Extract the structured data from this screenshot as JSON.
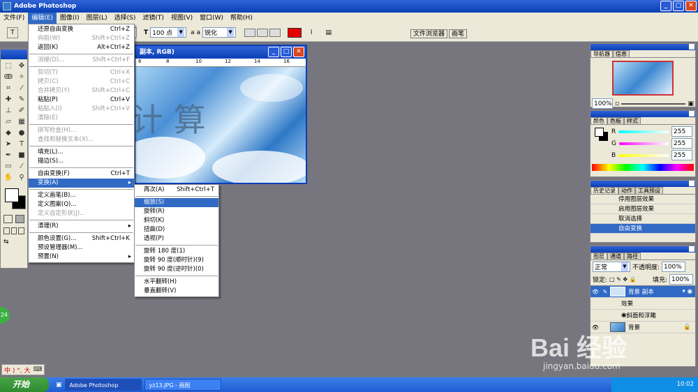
{
  "app": {
    "title": "Adobe Photoshop"
  },
  "menubar": [
    "文件(F)",
    "编辑(E)",
    "图像(I)",
    "图层(L)",
    "选择(S)",
    "滤镜(T)",
    "视图(V)",
    "窗口(W)",
    "帮助(H)"
  ],
  "options": {
    "font_size": "100 点",
    "antialias_icon": "a a",
    "antialias": "锐化",
    "color": "#e60000"
  },
  "palette_well": [
    "文件浏览器",
    "画笔"
  ],
  "document": {
    "title": "副本, RGB)",
    "ruler": [
      "6",
      "8",
      "10",
      "12",
      "14",
      "16"
    ],
    "text": "计 算"
  },
  "edit_menu": [
    {
      "label": "还原自由变换",
      "shortcut": "Ctrl+Z",
      "dis": false
    },
    {
      "label": "向前(W)",
      "shortcut": "Shift+Ctrl+Z",
      "dis": true
    },
    {
      "label": "返回(K)",
      "shortcut": "Alt+Ctrl+Z",
      "dis": false
    },
    {
      "sep": true
    },
    {
      "label": "消褪(D)...",
      "shortcut": "Shift+Ctrl+F",
      "dis": true
    },
    {
      "sep": true
    },
    {
      "label": "剪切(T)",
      "shortcut": "Ctrl+X",
      "dis": true
    },
    {
      "label": "拷贝(C)",
      "shortcut": "Ctrl+C",
      "dis": true
    },
    {
      "label": "合并拷贝(Y)",
      "shortcut": "Shift+Ctrl+C",
      "dis": true
    },
    {
      "label": "粘贴(P)",
      "shortcut": "Ctrl+V",
      "dis": false
    },
    {
      "label": "粘贴入(I)",
      "shortcut": "Shift+Ctrl+V",
      "dis": true
    },
    {
      "label": "清除(E)",
      "shortcut": "",
      "dis": true
    },
    {
      "sep": true
    },
    {
      "label": "拼写检查(H)...",
      "shortcut": "",
      "dis": true
    },
    {
      "label": "查找和替换文本(X)...",
      "shortcut": "",
      "dis": true
    },
    {
      "sep": true
    },
    {
      "label": "填充(L)...",
      "shortcut": "",
      "dis": false
    },
    {
      "label": "描边(S)...",
      "shortcut": "",
      "dis": false
    },
    {
      "sep": true
    },
    {
      "label": "自由变换(F)",
      "shortcut": "Ctrl+T",
      "dis": false
    },
    {
      "label": "变换(A)",
      "shortcut": "",
      "dis": false,
      "hl": true,
      "sub": true
    },
    {
      "sep": true
    },
    {
      "label": "定义画笔(B)...",
      "shortcut": "",
      "dis": false
    },
    {
      "label": "定义图案(Q)...",
      "shortcut": "",
      "dis": false
    },
    {
      "label": "定义自定形状(J)...",
      "shortcut": "",
      "dis": true
    },
    {
      "sep": true
    },
    {
      "label": "清理(R)",
      "shortcut": "",
      "dis": false,
      "sub": true
    },
    {
      "sep": true
    },
    {
      "label": "颜色设置(G)...",
      "shortcut": "Shift+Ctrl+K",
      "dis": false
    },
    {
      "label": "预设管理器(M)...",
      "shortcut": "",
      "dis": false
    },
    {
      "label": "预置(N)",
      "shortcut": "",
      "dis": false,
      "sub": true
    }
  ],
  "transform_menu": [
    {
      "label": "再次(A)",
      "shortcut": "Shift+Ctrl+T"
    },
    {
      "sep": true
    },
    {
      "label": "缩放(S)",
      "hl": true
    },
    {
      "label": "旋转(R)"
    },
    {
      "label": "斜切(K)"
    },
    {
      "label": "扭曲(D)"
    },
    {
      "label": "透视(P)"
    },
    {
      "sep": true
    },
    {
      "label": "旋转 180 度(1)"
    },
    {
      "label": "旋转 90 度(顺时针)(9)"
    },
    {
      "label": "旋转 90 度(逆时针)(0)"
    },
    {
      "sep": true
    },
    {
      "label": "水平翻转(H)"
    },
    {
      "label": "垂直翻转(V)"
    }
  ],
  "navigator": {
    "tabs": [
      "导航器",
      "信息"
    ],
    "zoom": "100%"
  },
  "color_panel": {
    "tabs": [
      "颜色",
      "色板",
      "样式"
    ],
    "channels": [
      {
        "name": "R",
        "value": "255"
      },
      {
        "name": "G",
        "value": "255"
      },
      {
        "name": "B",
        "value": "255"
      }
    ]
  },
  "history_panel": {
    "tabs": [
      "历史记录",
      "动作",
      "工具预设"
    ],
    "items": [
      "停用图层效果",
      "启用图层效果",
      "取消选择",
      "自由变换"
    ]
  },
  "layers_panel": {
    "tabs": [
      "图层",
      "通道",
      "路径"
    ],
    "blend": "正常",
    "opacity_label": "不透明度:",
    "opacity": "100%",
    "lock_label": "锁定:",
    "fill_label": "填充:",
    "fill": "100%",
    "layers": [
      "背景 副本",
      "效果",
      "斜面和浮雕",
      "背景"
    ]
  },
  "taskbar": {
    "start": "开始",
    "tasks": [
      "Adobe Photoshop",
      "yz13.JPG - 画图"
    ],
    "time": "10:02"
  },
  "ime": "中 ) °, 大",
  "watermark": {
    "logo": "Bai 经验",
    "url": "jingyan.baidu.com"
  },
  "badge": "24"
}
